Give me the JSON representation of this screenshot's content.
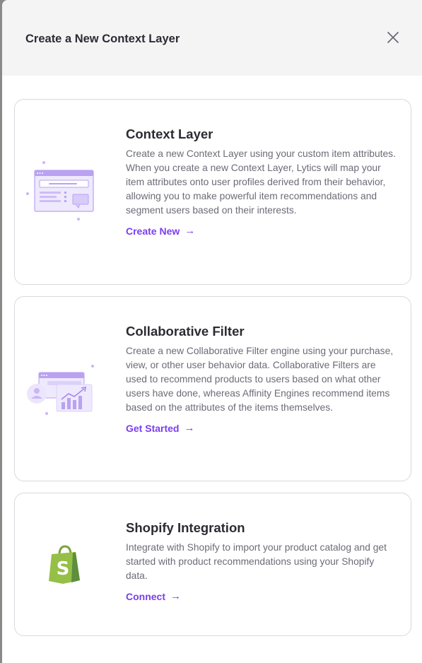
{
  "modal": {
    "title": "Create a New Context Layer"
  },
  "cards": [
    {
      "title": "Context Layer",
      "description": "Create a new Context Layer using your custom item attributes. When you create a new Context Layer, Lytics will map your item attributes onto user profiles derived from their behavior, allowing you to make powerful item recommendations and segment users based on their interests.",
      "link_label": "Create New",
      "arrow": "→",
      "icon": "context-layer-illustration"
    },
    {
      "title": "Collaborative Filter",
      "description": "Create a new Collaborative Filter engine using your purchase, view, or other user behavior data. Collaborative Filters are used to recommend products to users based on what other users have done, whereas Affinity Engines recommend items based on the attributes of the items themselves.",
      "link_label": "Get Started",
      "arrow": "→",
      "icon": "collaborative-filter-illustration"
    },
    {
      "title": "Shopify Integration",
      "description": "Integrate with Shopify to import your product catalog and get started with product recommendations using your Shopify data.",
      "link_label": "Connect",
      "arrow": "→",
      "icon": "shopify-logo"
    }
  ],
  "colors": {
    "accent": "#7a3ef0",
    "illustration": "#b9a2f2",
    "shopify_green": "#95bf47"
  }
}
